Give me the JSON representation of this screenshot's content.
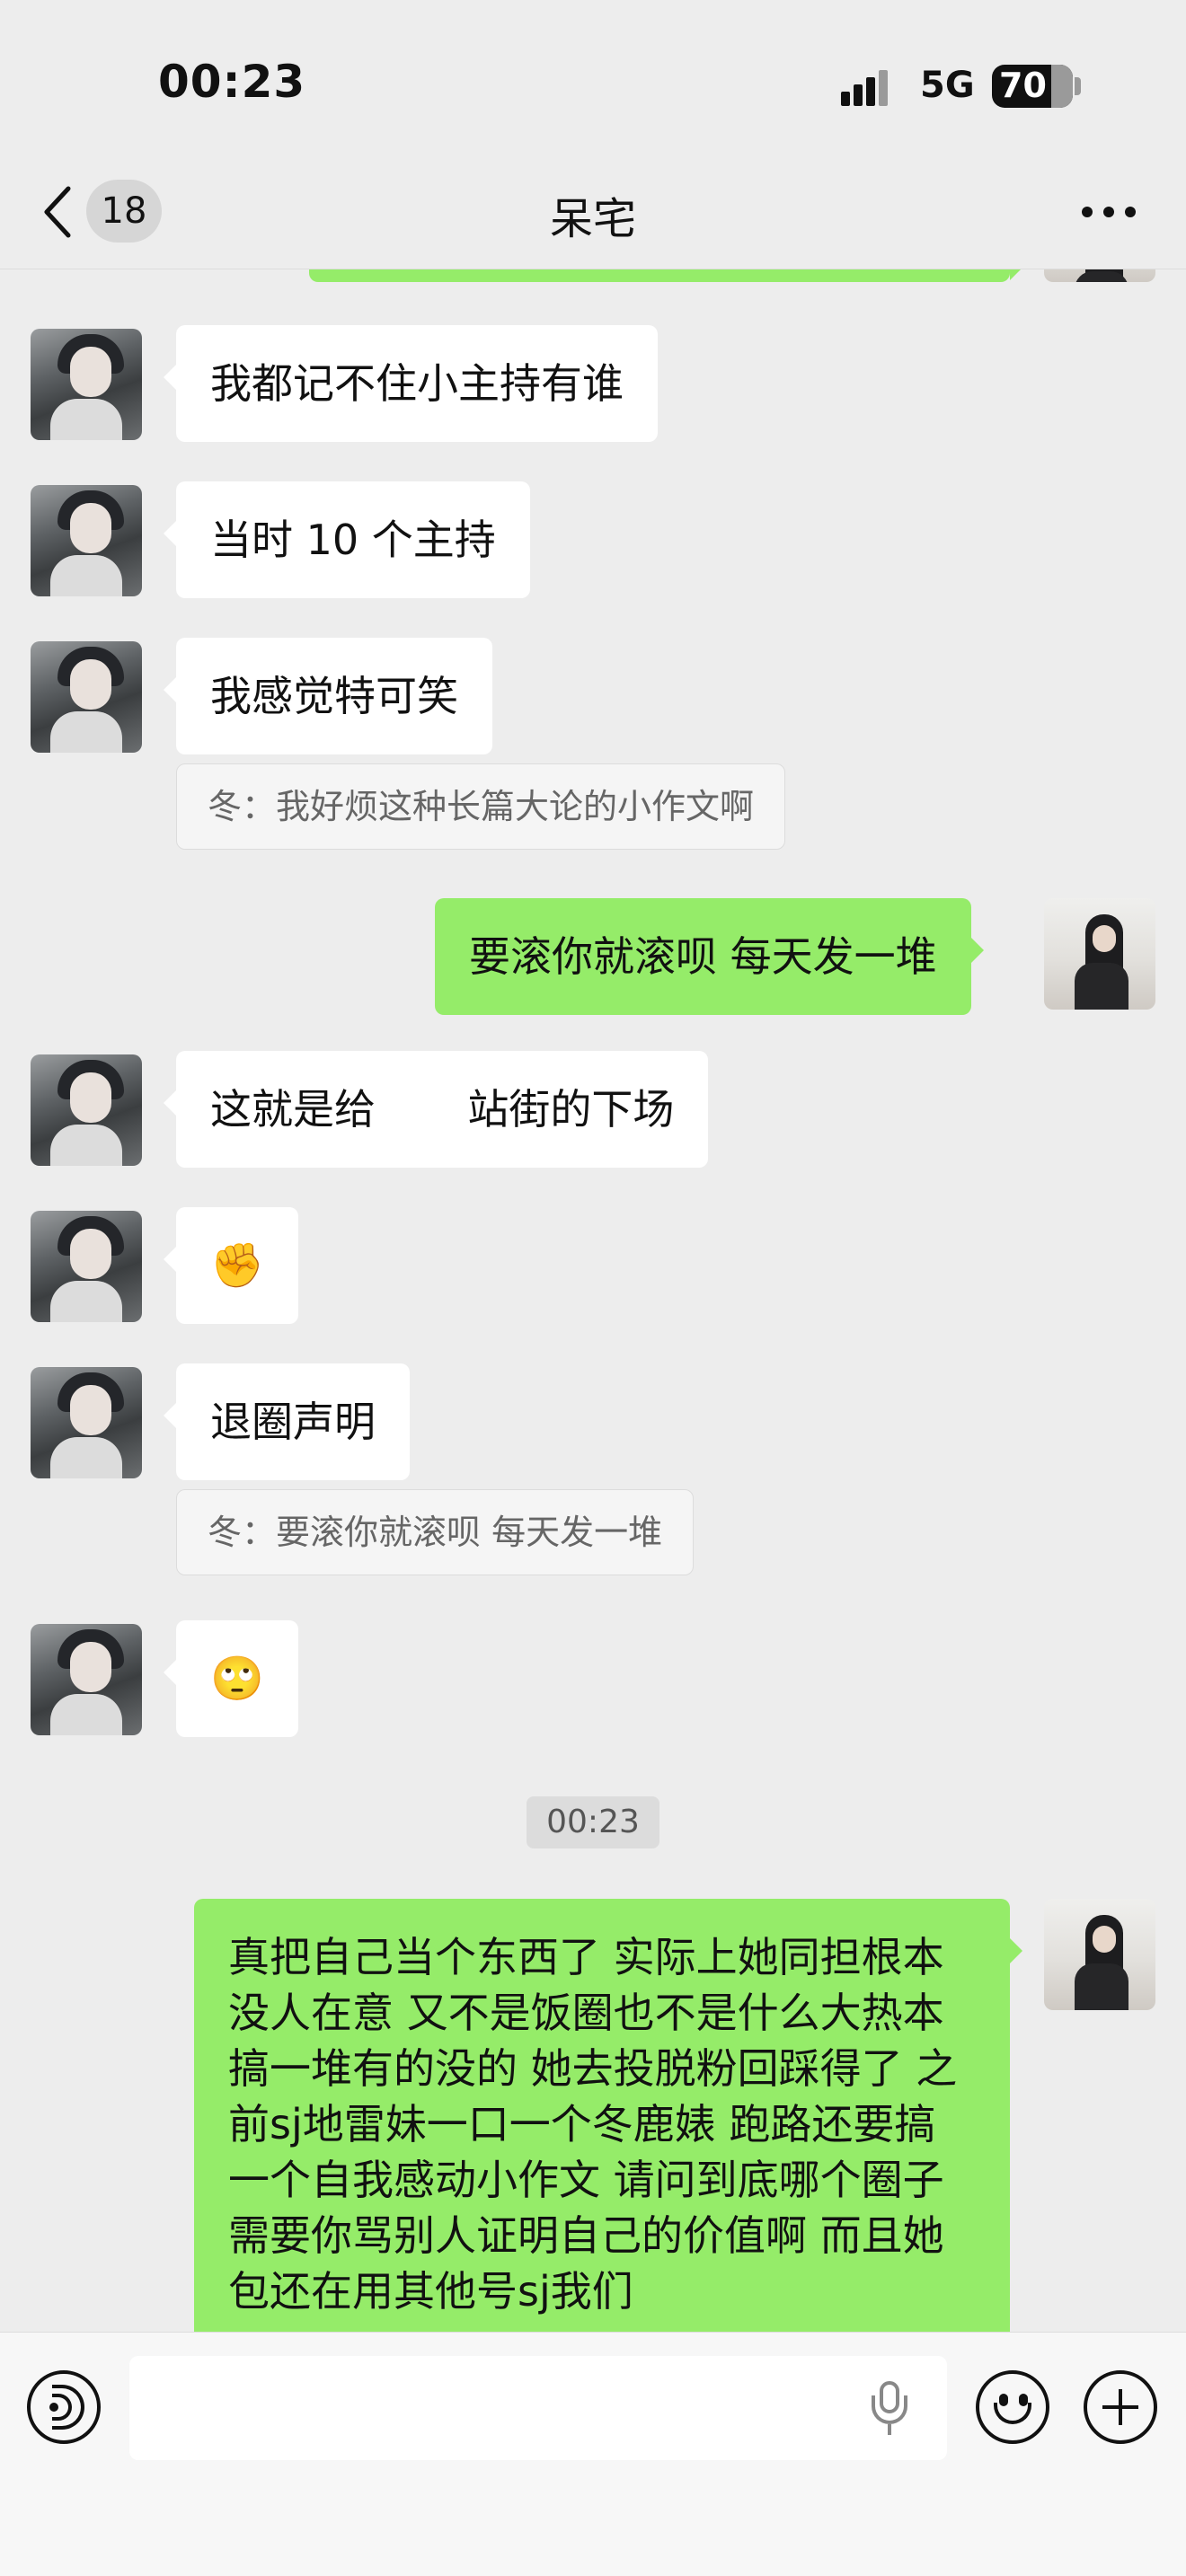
{
  "status_bar": {
    "time": "00:23",
    "network": "5G",
    "battery": "70"
  },
  "nav": {
    "back_count": "18",
    "title": "呆宅"
  },
  "messages": [
    {
      "side": "in",
      "text": "我都记不住小主持有谁"
    },
    {
      "side": "in",
      "text": "当时 10 个主持"
    },
    {
      "side": "in",
      "text": "我感觉特可笑",
      "quote": "冬：我好烦这种长篇大论的小作文啊"
    },
    {
      "side": "out",
      "text": "要滚你就滚呗 每天发一堆"
    },
    {
      "side": "in",
      "text": "这就是给       站街的下场"
    },
    {
      "side": "in",
      "emoji": "✊"
    },
    {
      "side": "in",
      "text": "退圈声明",
      "quote": "冬：要滚你就滚呗 每天发一堆"
    },
    {
      "side": "in",
      "emoji": "🙄"
    },
    {
      "side": "out",
      "text": "真把自己当个东西了 实际上她同担根本没人在意 又不是饭圈也不是什么大热本 搞一堆有的没的 她去投脱粉回踩得了 之前sj地雷妹一口一个冬鹿婊 跑路还要搞一个自我感动小作文 请问到底哪个圈子需要你骂别人证明自己的价值啊 而且她包还在用其他号sj我们"
    }
  ],
  "timestamp": "00:23",
  "icons": {
    "back": "chevron-left-icon",
    "more": "more-horizontal-icon",
    "voice": "voice-input-icon",
    "mic": "microphone-icon",
    "emoji": "emoji-icon",
    "plus": "plus-icon"
  }
}
